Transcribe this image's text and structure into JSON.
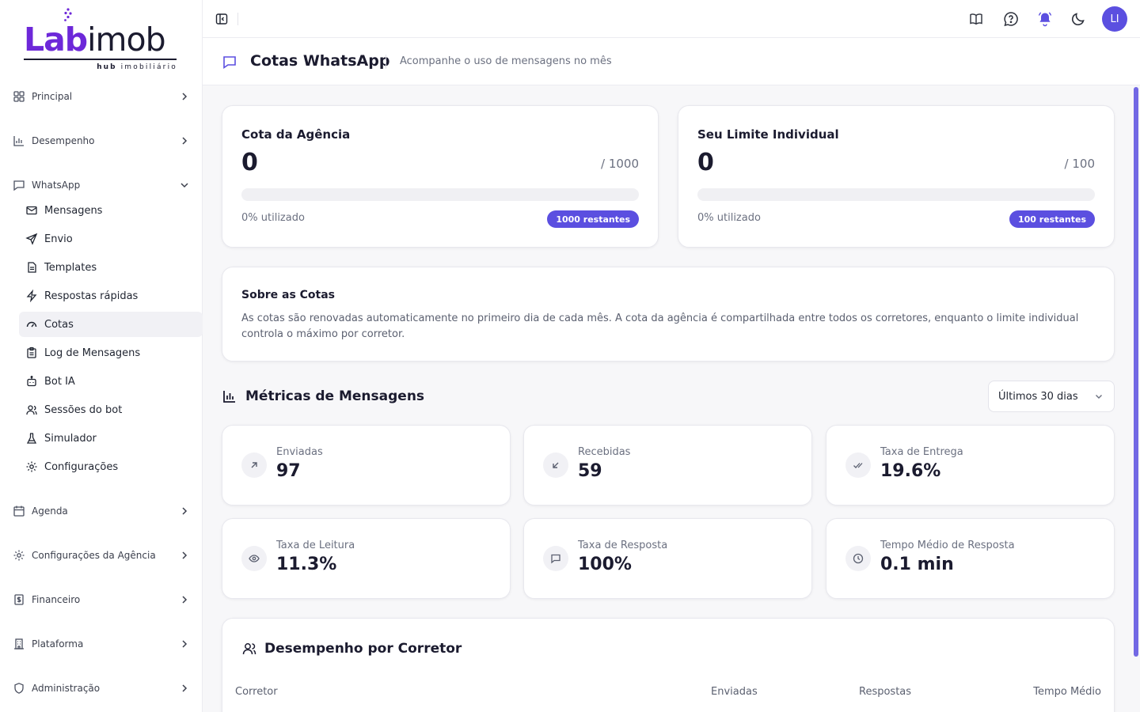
{
  "brand": {
    "logo_main": "Lab",
    "logo_rest": "imob",
    "logo_sub_bold": "hub",
    "logo_sub": "imobiliário",
    "accent": "#5b4fe0",
    "logo_color": "#6d28d9"
  },
  "sidebar": {
    "groups": [
      {
        "label": "Principal",
        "icon": "grid-icon"
      },
      {
        "label": "Desempenho",
        "icon": "bar-chart-icon"
      },
      {
        "label": "WhatsApp",
        "icon": "chat-icon"
      },
      {
        "label": "Agenda",
        "icon": "calendar-icon"
      },
      {
        "label": "Configurações da Agência",
        "icon": "gear-icon"
      },
      {
        "label": "Financeiro",
        "icon": "receipt-icon"
      },
      {
        "label": "Plataforma",
        "icon": "building-icon"
      },
      {
        "label": "Administração",
        "icon": "shield-icon"
      }
    ],
    "whatsapp_items": [
      {
        "label": "Mensagens",
        "icon": "mail-icon"
      },
      {
        "label": "Envio",
        "icon": "send-icon"
      },
      {
        "label": "Templates",
        "icon": "file-icon"
      },
      {
        "label": "Respostas rápidas",
        "icon": "zap-icon"
      },
      {
        "label": "Cotas",
        "icon": "gauge-icon",
        "active": true
      },
      {
        "label": "Log de Mensagens",
        "icon": "clipboard-icon"
      },
      {
        "label": "Bot IA",
        "icon": "bot-icon"
      },
      {
        "label": "Sessões do bot",
        "icon": "users-icon"
      },
      {
        "label": "Simulador",
        "icon": "flask-icon"
      },
      {
        "label": "Configurações",
        "icon": "gear-icon"
      }
    ]
  },
  "topbar": {
    "avatar_initials": "LI",
    "icons": [
      "book-icon",
      "help-chat-icon",
      "bell-icon",
      "moon-icon"
    ]
  },
  "page": {
    "title": "Cotas WhatsApp",
    "subtitle": "Acompanhe o uso de mensagens no mês"
  },
  "quotas": [
    {
      "title": "Cota da Agência",
      "value": "0",
      "max": "/ 1000",
      "used_label": "0% utilizado",
      "used_fraction": 0,
      "badge": "1000 restantes"
    },
    {
      "title": "Seu Limite Individual",
      "value": "0",
      "max": "/ 100",
      "used_label": "0% utilizado",
      "used_fraction": 0,
      "badge": "100 restantes"
    }
  ],
  "about": {
    "title": "Sobre as Cotas",
    "text": "As cotas são renovadas automaticamente no primeiro dia de cada mês. A cota da agência é compartilhada entre todos os corretores, enquanto o limite individual controla o máximo por corretor."
  },
  "metrics": {
    "title": "Métricas de Mensagens",
    "period": "Últimos 30 dias",
    "cards": [
      {
        "label": "Enviadas",
        "value": "97",
        "icon": "arrow-up-right-icon"
      },
      {
        "label": "Recebidas",
        "value": "59",
        "icon": "arrow-down-left-icon"
      },
      {
        "label": "Taxa de Entrega",
        "value": "19.6%",
        "icon": "double-check-icon"
      },
      {
        "label": "Taxa de Leitura",
        "value": "11.3%",
        "icon": "eye-icon"
      },
      {
        "label": "Taxa de Resposta",
        "value": "100%",
        "icon": "message-square-icon"
      },
      {
        "label": "Tempo Médio de Resposta",
        "value": "0.1 min",
        "icon": "clock-icon"
      }
    ]
  },
  "performance": {
    "title": "Desempenho por Corretor",
    "columns": [
      "Corretor",
      "Enviadas",
      "Respostas",
      "Tempo Médio"
    ]
  }
}
